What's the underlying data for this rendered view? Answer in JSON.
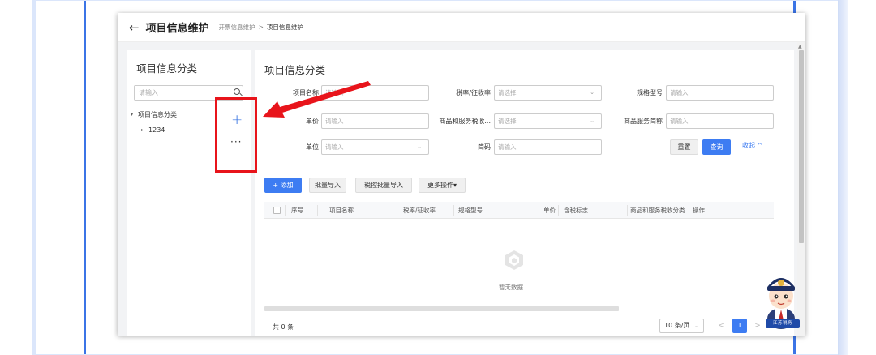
{
  "header": {
    "title": "项目信息维护",
    "breadcrumb_parent": "开票信息维护",
    "breadcrumb_sep": ">",
    "breadcrumb_current": "项目信息维护"
  },
  "left_panel": {
    "title": "项目信息分类",
    "search_placeholder": "请输入",
    "tree": {
      "root_label": "项目信息分类",
      "child_label": "1234"
    },
    "annotation": {
      "plus": "+",
      "more": "···"
    }
  },
  "main": {
    "title": "项目信息分类",
    "filters": {
      "item_name_label": "项目名称",
      "item_name_placeholder": "请输入",
      "tax_rate_label": "税率/征收率",
      "tax_rate_placeholder": "请选择",
      "spec_label": "规格型号",
      "spec_placeholder": "请输入",
      "unit_price_label": "单价",
      "unit_price_placeholder": "请输入",
      "tax_code_label": "商品和服务税收...",
      "tax_code_placeholder": "请选择",
      "service_short_label": "商品服务简称",
      "service_short_placeholder": "请输入",
      "unit_label": "单位",
      "unit_placeholder": "请输入",
      "short_code_label": "简码",
      "short_code_placeholder": "请输入"
    },
    "buttons": {
      "reset": "重置",
      "query": "查询",
      "collapse": "收起 ^",
      "add": "+ 添加",
      "batch_import": "批量导入",
      "tax_batch_import": "税控批量导入",
      "more_actions": "更多操作▾"
    },
    "table": {
      "columns": [
        "序号",
        "项目名称",
        "税率/征收率",
        "规格型号",
        "单价",
        "含税标志",
        "商品和服务税收分类",
        "操作"
      ],
      "empty_text": "暂无数据"
    },
    "pagination": {
      "total": "共 0 条",
      "page_size": "10 条/页",
      "prev": "<",
      "current_page": "1",
      "next": ">"
    }
  },
  "mascot": {
    "badge": "江苏税务"
  },
  "icons": {
    "back": "arrow-left-icon",
    "search": "search-icon",
    "empty": "empty-box-icon",
    "chevron": "chevron-down-icon"
  },
  "colors": {
    "primary": "#3d7cf2",
    "annotation": "#e8141b",
    "frame": "#3b74e6"
  }
}
